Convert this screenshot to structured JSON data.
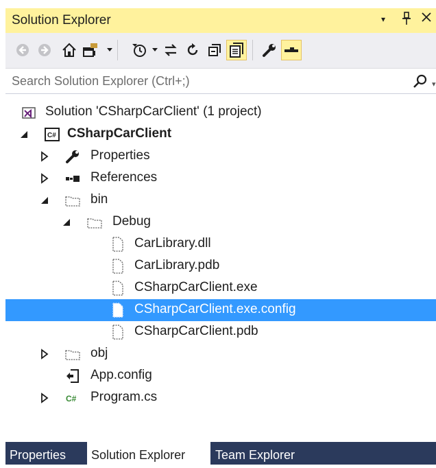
{
  "window": {
    "title": "Solution Explorer",
    "dropdown_glyph": "▾",
    "pin_glyph": "📌",
    "close_glyph": "✕"
  },
  "toolbar": {
    "buttons": [
      {
        "icon": "back-icon"
      },
      {
        "icon": "forward-icon"
      },
      {
        "icon": "home-icon"
      },
      {
        "icon": "switch-views-icon"
      },
      {
        "icon": "pending-changes-filter-icon"
      },
      {
        "icon": "sync-with-active-document-icon"
      },
      {
        "icon": "refresh-icon"
      },
      {
        "icon": "collapse-all-icon"
      },
      {
        "icon": "show-all-files-icon",
        "active": true
      },
      {
        "icon": "properties-wrench-icon"
      },
      {
        "icon": "preview-selected-items-icon",
        "active": true
      }
    ]
  },
  "search": {
    "placeholder": "Search Solution Explorer (Ctrl+;)",
    "caret": "▾"
  },
  "tree": {
    "items": [
      {
        "label": "Solution 'CSharpCarClient' (1 project)",
        "icon": "solution-icon",
        "bold": false
      },
      {
        "label": "CSharpCarClient",
        "icon": "csharp-project-icon",
        "bold": true
      },
      {
        "label": "Properties",
        "icon": "wrench-icon"
      },
      {
        "label": "References",
        "icon": "references-icon"
      },
      {
        "label": "bin",
        "icon": "folder-hidden-icon"
      },
      {
        "label": "Debug",
        "icon": "folder-hidden-icon"
      },
      {
        "label": "CarLibrary.dll",
        "icon": "file-hidden-icon"
      },
      {
        "label": "CarLibrary.pdb",
        "icon": "file-hidden-icon"
      },
      {
        "label": "CSharpCarClient.exe",
        "icon": "file-hidden-icon"
      },
      {
        "label": "CSharpCarClient.exe.config",
        "icon": "file-hidden-icon",
        "selected": true
      },
      {
        "label": "CSharpCarClient.pdb",
        "icon": "file-hidden-icon"
      },
      {
        "label": "obj",
        "icon": "folder-hidden-icon"
      },
      {
        "label": "App.config",
        "icon": "config-file-icon"
      },
      {
        "label": "Program.cs",
        "icon": "csharp-file-icon"
      }
    ]
  },
  "tabs": [
    {
      "label": "Properties",
      "active": false
    },
    {
      "label": "Solution Explorer",
      "active": true
    },
    {
      "label": "Team Explorer",
      "active": false
    }
  ],
  "colors": {
    "title_bar": "#fff29d",
    "selection": "#3399ff",
    "tab_strip": "#2b3a5c",
    "toolbar": "#eeeef2"
  }
}
